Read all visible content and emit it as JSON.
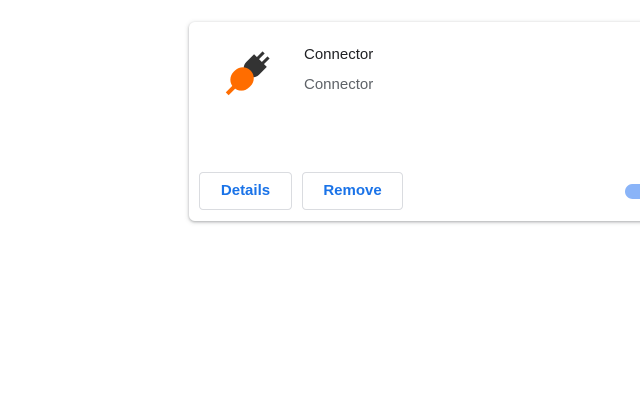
{
  "extension": {
    "name": "Connector",
    "description": "Connector",
    "icon": "plug-connector-icon",
    "enabled": true
  },
  "actions": {
    "details_label": "Details",
    "remove_label": "Remove"
  },
  "colors": {
    "accent": "#1a73e8",
    "toggle_track": "#8ab4f8",
    "icon_orange": "#ff6d00",
    "icon_dark": "#333333"
  }
}
